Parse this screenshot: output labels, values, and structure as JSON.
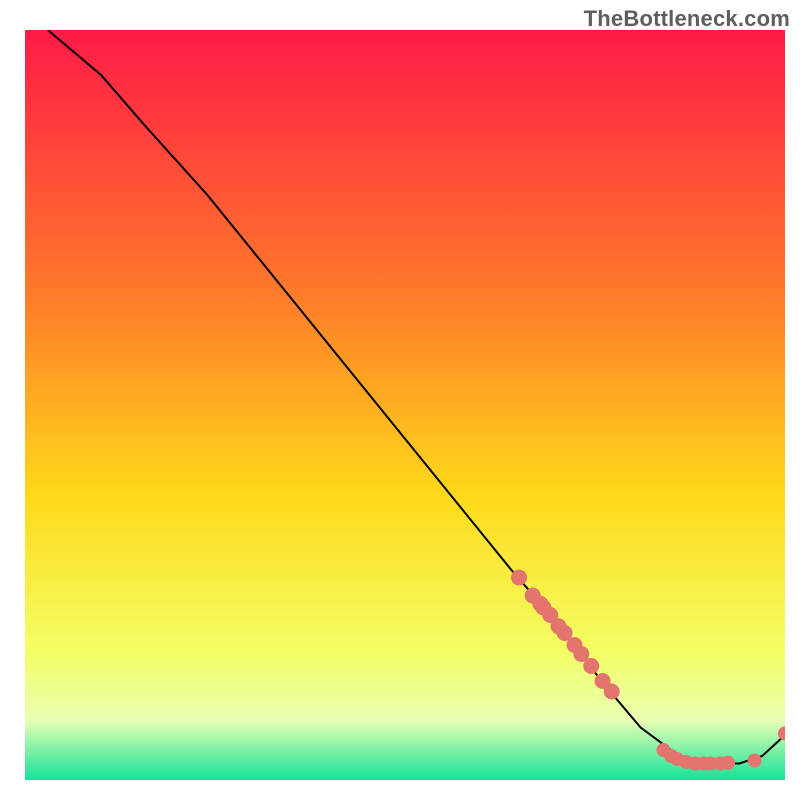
{
  "attribution": "TheBottleneck.com",
  "chart_data": {
    "type": "line",
    "title": "",
    "xlabel": "",
    "ylabel": "",
    "xlim": [
      0,
      100
    ],
    "ylim": [
      0,
      100
    ],
    "legend": false,
    "grid": false,
    "background_gradient": {
      "top": "#ff1a47",
      "upper_mid": "#ff7a2a",
      "mid": "#ffd91a",
      "lower_mid": "#f3ff66",
      "band": "#e9ffb3",
      "bottom": "#15e29a"
    },
    "series": [
      {
        "name": "curve",
        "type": "line",
        "color": "#000000",
        "x": [
          3,
          10,
          16,
          24,
          32,
          40,
          48,
          56,
          64,
          70,
          76,
          81,
          85,
          88,
          91,
          94,
          97,
          100
        ],
        "y": [
          100,
          94,
          87,
          78,
          68,
          58,
          48,
          38,
          28,
          21,
          13,
          7,
          4,
          2.4,
          2.2,
          2.2,
          3.2,
          6
        ]
      },
      {
        "name": "upper-cluster-dots",
        "type": "scatter",
        "color": "#e4746e",
        "x": [
          65,
          66.8,
          67.8,
          68.2,
          69.1,
          70.2,
          71.0,
          72.3,
          73.2,
          74.5,
          76.0,
          77.2
        ],
        "y": [
          27.0,
          24.6,
          23.5,
          23.0,
          22.0,
          20.5,
          19.6,
          18.0,
          16.8,
          15.2,
          13.2,
          11.8
        ]
      },
      {
        "name": "valley-dots",
        "type": "scatter",
        "color": "#e4746e",
        "x": [
          84.0,
          85.0,
          85.8,
          87.0,
          88.2,
          89.3,
          90.2,
          91.5,
          92.5,
          96.0,
          100.0
        ],
        "y": [
          4.0,
          3.2,
          2.8,
          2.4,
          2.2,
          2.2,
          2.2,
          2.2,
          2.3,
          2.6,
          6.2
        ]
      }
    ]
  }
}
